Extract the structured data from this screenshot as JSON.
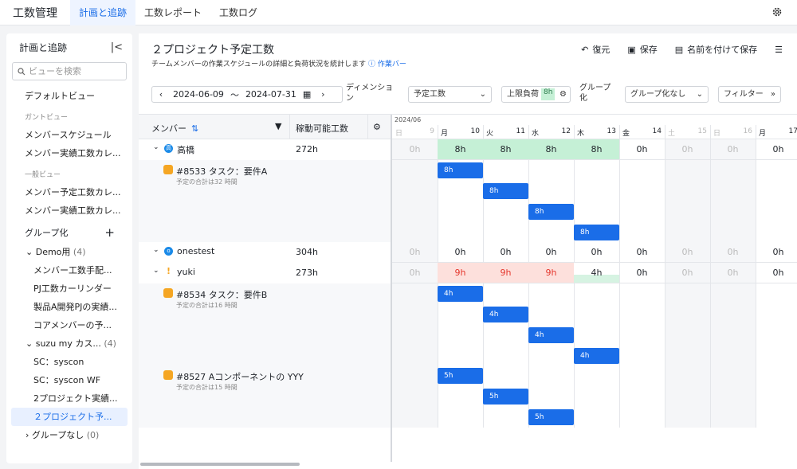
{
  "topbar": {
    "app_title": "工数管理",
    "tabs": [
      "計画と追跡",
      "工数レポート",
      "工数ログ"
    ],
    "active_tab": "計画と追跡"
  },
  "sidebar": {
    "title": "計画と追跡",
    "search_placeholder": "ビューを検索",
    "default_view": "デフォルトビュー",
    "gantt_section": "ガントビュー",
    "gantt_items": [
      "メンバースケジュール",
      "メンバー実績工数カレ..."
    ],
    "general_section": "一般ビュー",
    "general_items": [
      "メンバー予定工数カレ...",
      "メンバー実績工数カレ..."
    ],
    "group_label": "グループ化",
    "folders": [
      {
        "name": "Demo用",
        "count": "(4)",
        "items": [
          "メンバー工数手配...",
          "PJ工数カーリンダー",
          "製品A開発PJの実績...",
          "コアメンバーの予..."
        ]
      },
      {
        "name": "suzu my カス...",
        "count": "(4)",
        "items": [
          "SC：syscon",
          "SC：syscon WF",
          "2プロジェクト実績...",
          "２プロジェクト予..."
        ]
      },
      {
        "name": "グループなし",
        "count": "(0)",
        "items": []
      }
    ]
  },
  "main": {
    "title": "２プロジェクト予定工数",
    "subtitle": "チームメンバーの作業スケジュールの詳細と負荷状況を統計します",
    "subtitle_link": "作業バー",
    "actions": [
      "復元",
      "保存",
      "名前を付けて保存"
    ],
    "date_start": "2024-06-09",
    "date_sep": "〜",
    "date_end": "2024-07-31",
    "dimension_label": "ディメンション",
    "dimension_value": "予定工数",
    "cap_label": "上限負荷",
    "cap_value": "8h",
    "group_label": "グループ化",
    "group_value": "グループ化なし",
    "filter_label": "フィルター"
  },
  "table": {
    "col_member": "メンバー",
    "col_hours": "稼動可能工数",
    "month": "2024/06",
    "days": [
      {
        "wd": "日",
        "dn": "9",
        "off": true
      },
      {
        "wd": "月",
        "dn": "10",
        "off": false
      },
      {
        "wd": "火",
        "dn": "11",
        "off": false
      },
      {
        "wd": "水",
        "dn": "12",
        "off": false
      },
      {
        "wd": "木",
        "dn": "13",
        "off": false
      },
      {
        "wd": "金",
        "dn": "14",
        "off": false
      },
      {
        "wd": "土",
        "dn": "15",
        "off": true
      },
      {
        "wd": "日",
        "dn": "16",
        "off": true
      },
      {
        "wd": "月",
        "dn": "17",
        "off": false
      }
    ],
    "members": [
      {
        "name": "高橋",
        "avatar": "高",
        "hours": "272h",
        "cells": [
          "0h",
          "8h",
          "8h",
          "8h",
          "8h",
          "0h",
          "0h",
          "0h",
          "0h"
        ],
        "load": [
          "off",
          "green",
          "green",
          "green",
          "green",
          "",
          "off",
          "off",
          ""
        ]
      },
      {
        "name": "onestest",
        "avatar": "o",
        "hours": "304h",
        "cells": [
          "0h",
          "0h",
          "0h",
          "0h",
          "0h",
          "0h",
          "0h",
          "0h",
          "0h"
        ],
        "load": [
          "off",
          "",
          "",
          "",
          "",
          "",
          "off",
          "off",
          ""
        ]
      },
      {
        "name": "yuki",
        "avatar": "!",
        "hours": "273h",
        "cells": [
          "0h",
          "9h",
          "9h",
          "9h",
          "4h",
          "0h",
          "0h",
          "0h",
          "0h"
        ],
        "load": [
          "off",
          "red",
          "red",
          "red",
          "half",
          "",
          "off",
          "off",
          ""
        ]
      }
    ],
    "tasks": [
      {
        "name": "#8533 タスク：要件A",
        "sum": "予定の合計は32 時間",
        "bars": [
          "8h",
          "8h",
          "8h",
          "8h"
        ]
      },
      {
        "name": "#8534 タスク：要件B",
        "sum": "予定の合計は16 時間",
        "bars": [
          "4h",
          "4h",
          "4h",
          "4h"
        ]
      },
      {
        "name": "#8527 Aコンポーネントの YYY",
        "sum": "予定の合計は15 時間",
        "bars": [
          "5h",
          "5h",
          "5h"
        ]
      }
    ]
  }
}
